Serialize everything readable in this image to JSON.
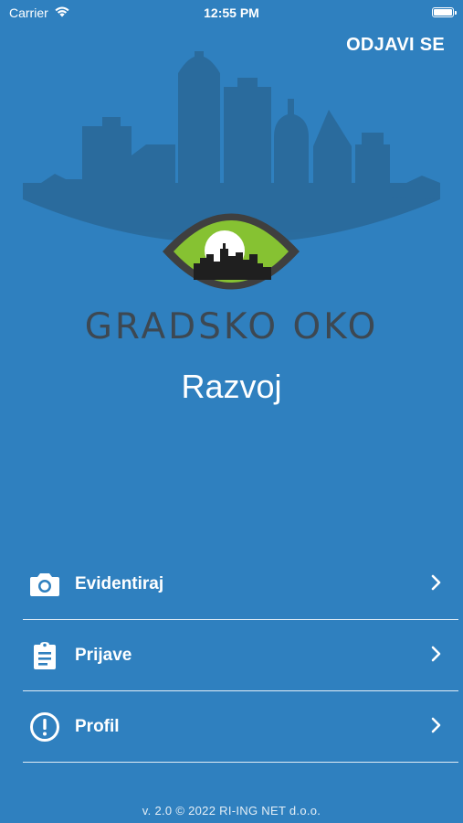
{
  "status_bar": {
    "carrier": "Carrier",
    "time": "12:55 PM",
    "wifi_icon": "wifi-icon",
    "battery_icon": "battery-icon"
  },
  "header": {
    "logout_label": "ODJAVI SE"
  },
  "branding": {
    "app_name": "GRADSKO OKO",
    "environment": "Razvoj",
    "logo_icon": "city-eye-logo",
    "colors": {
      "background": "#2f80bf",
      "skyline": "#2a6a9c",
      "eye_green": "#86c232",
      "title_gray": "#3d4852"
    }
  },
  "menu": {
    "items": [
      {
        "label": "Evidentiraj",
        "icon": "camera-icon"
      },
      {
        "label": "Prijave",
        "icon": "clipboard-icon"
      },
      {
        "label": "Profil",
        "icon": "alert-circle-icon"
      }
    ]
  },
  "footer": {
    "text": "v. 2.0 © 2022 RI-ING NET d.o.o."
  }
}
